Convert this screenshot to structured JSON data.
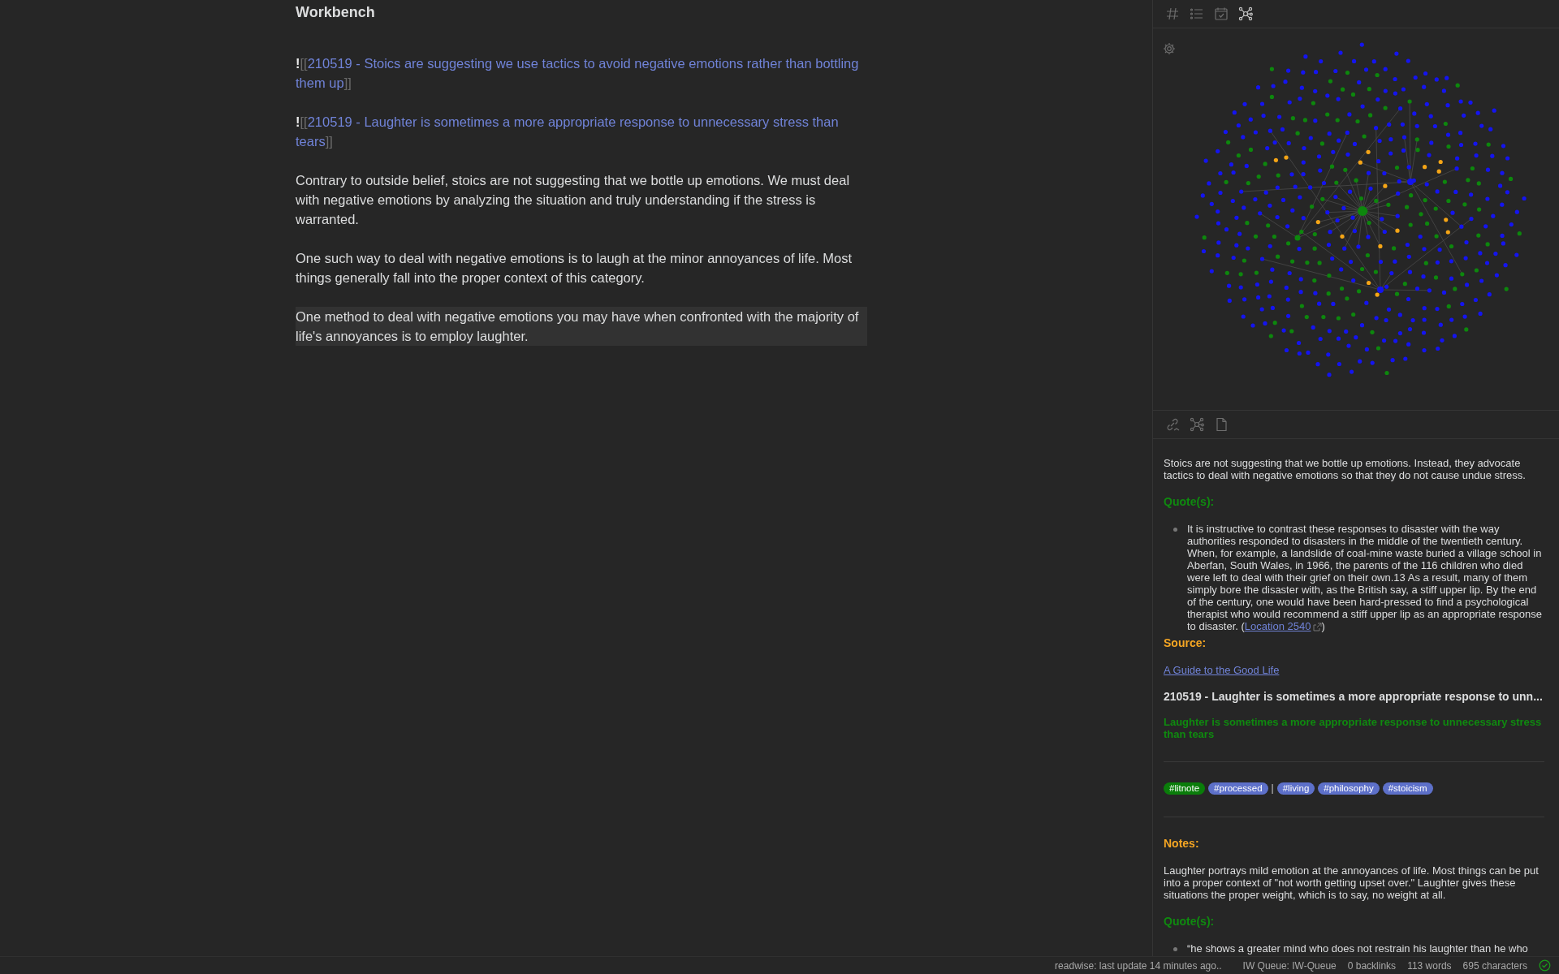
{
  "editor": {
    "title": "Workbench",
    "blocks": [
      {
        "kind": "embed",
        "prefix": "!",
        "open": "[[",
        "link": "210519 - Stoics are suggesting we use tactics to avoid negative emotions rather than bottling them up",
        "close": "]]"
      },
      {
        "kind": "embed",
        "prefix": "!",
        "open": "[[",
        "link": "210519 - Laughter is sometimes a more appropriate response to unnecessary stress than tears",
        "close": "]]"
      },
      {
        "kind": "paragraph",
        "text": "Contrary to outside belief, stoics are not suggesting that we bottle up emotions. We must deal with negative emotions by analyzing the situation and truly understanding if the stress is warranted.",
        "highlighted": false
      },
      {
        "kind": "paragraph",
        "text": "One such way to deal with negative emotions is to laugh at the minor annoyances of life. Most things generally fall into the proper context of this category.",
        "highlighted": false
      },
      {
        "kind": "paragraph",
        "text": "One method to deal with negative emotions you may have when confronted with the majority of life's annoyances is to employ laughter.",
        "highlighted": true
      }
    ]
  },
  "side_panel": {
    "top_tabs": [
      {
        "kind": "tags",
        "selected": false
      },
      {
        "kind": "outline",
        "selected": false
      },
      {
        "kind": "calendar",
        "selected": false
      },
      {
        "kind": "graph",
        "selected": true
      }
    ],
    "bottom_tabs": [
      {
        "kind": "backlinks"
      },
      {
        "kind": "graph"
      },
      {
        "kind": "file"
      }
    ],
    "preview": [
      {
        "kind": "text",
        "text": "Stoics are not suggesting that we bottle up emotions. Instead, they advocate tactics to deal with negative emotions so that they do not cause undue stress."
      },
      {
        "kind": "heading",
        "text": "Quote(s):",
        "color": "#0f8a0f"
      },
      {
        "kind": "bullet",
        "text": "It is instructive to contrast these responses to disaster with the way authorities responded to disasters in the middle of the twentieth century. When, for example, a landslide of coal-mine waste buried a village school in Aberfan, South Wales, in 1966, the parents of the 116 children who died were left to deal with their grief on their own.13 As a result, many of them simply bore the disaster with, as the British say, a stiff upper lip. By the end of the century, one would have been hard-pressed to find a psychological therapist who would recommend a stiff upper lip as an appropriate response to disaster. (",
        "link": "Location 2540",
        "after": ")"
      },
      {
        "kind": "heading",
        "text": "Source:",
        "color": "#f5a623"
      },
      {
        "kind": "link",
        "text": "A Guide to the Good Life"
      },
      {
        "kind": "title",
        "text": "210519 - Laughter is sometimes a more appropriate response to unn..."
      },
      {
        "kind": "subtitle",
        "text": "Laughter is sometimes a more appropriate response to unnecessary stress than tears"
      },
      {
        "kind": "rule"
      },
      {
        "kind": "tags",
        "tags": [
          {
            "kind": "tag",
            "text": "#litnote",
            "color": "#0a7d0a"
          },
          {
            "kind": "tag",
            "text": "#processed",
            "color": "#5d70c9"
          },
          {
            "kind": "separator",
            "text": "|"
          },
          {
            "kind": "tag",
            "text": "#living",
            "color": "#5d70c9"
          },
          {
            "kind": "tag",
            "text": "#philosophy",
            "color": "#5d70c9"
          },
          {
            "kind": "tag",
            "text": "#stoicism",
            "color": "#5d70c9"
          }
        ]
      },
      {
        "kind": "rule"
      },
      {
        "kind": "heading",
        "text": "Notes:",
        "color": "#f5a623"
      },
      {
        "kind": "text",
        "text": "Laughter portrays mild emotion at the annoyances of life. Most things can be put into a proper context of \"not worth getting upset over.\" Laughter gives these situations the proper weight, which is to say, no weight at all."
      },
      {
        "kind": "heading",
        "text": "Quote(s):",
        "color": "#0f8a0f"
      },
      {
        "kind": "bullet",
        "text": "“he shows a greater mind who does not restrain his laughter than he who"
      }
    ]
  },
  "status_bar": {
    "items": [
      "readwise: last update 14 minutes ago..",
      "IW Queue: IW-Queue",
      "0 backlinks",
      "113 words",
      "695 characters"
    ]
  }
}
